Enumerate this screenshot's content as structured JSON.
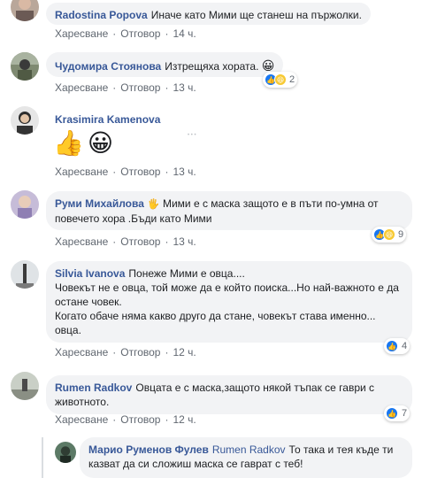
{
  "actions": {
    "like": "Харесване",
    "reply": "Отговор",
    "sep": "·"
  },
  "comments": [
    {
      "author": "Radostina Popova",
      "text": "Иначе като Мими ще станеш на пържолки.",
      "time": "14 ч."
    },
    {
      "author": "Чудомира Стоянова",
      "text": "Изтрещяха хората.",
      "emoji": "😀",
      "time": "13 ч.",
      "reactions": {
        "count": "2"
      }
    },
    {
      "author": "Krasimira Kamenova",
      "stickers": [
        "👍",
        "😀"
      ],
      "time": "13 ч.",
      "more": "• • •"
    },
    {
      "author": "Руми Михайлова",
      "author_emoji": "🖐",
      "text": "Мими е с маска защото е в пъти по-умна от повечето хора .Бъди като Мими",
      "time": "13 ч.",
      "reactions": {
        "count": "9"
      }
    },
    {
      "author": "Silvia Ivanova",
      "lines": [
        "Понеже Мими е овца....",
        "Човекът не е овца, той може да е който поиска...Но най-важното е да остане човек.",
        "Когато обаче няма какво друго да стане, човекът става именно... овца."
      ],
      "time": "12 ч.",
      "reactions": {
        "count": "4"
      }
    },
    {
      "author": "Rumen Radkov",
      "text": "Овцата е с маска,защото някой тъпак се гаври с животното.",
      "time": "12 ч.",
      "reactions": {
        "count": "7"
      }
    },
    {
      "author": "Марио Руменов Фулев",
      "mention": "Rumen Radkov",
      "text": "То така и тея къде ти казват да си сложиш маска се гаврат с теб!"
    }
  ],
  "colors": {
    "link": "#385898",
    "bubble": "#f2f3f5",
    "meta": "#606770",
    "like": "#1877f2",
    "haha": "#f7c932"
  },
  "icons": {
    "like": "thumbs-up-icon",
    "haha": "laughing-face-icon"
  }
}
